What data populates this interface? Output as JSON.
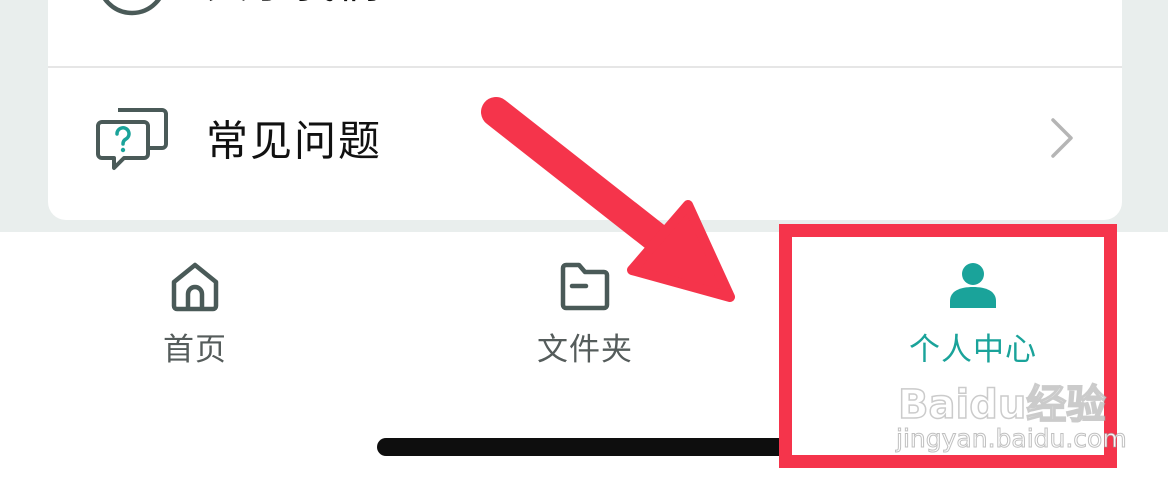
{
  "menu": {
    "items": [
      {
        "label": "关于我们",
        "icon": "info-circle-icon"
      },
      {
        "label": "常见问题",
        "icon": "question-chat-icon"
      }
    ]
  },
  "tabbar": {
    "tabs": [
      {
        "label": "首页",
        "icon": "home-icon",
        "active": false
      },
      {
        "label": "文件夹",
        "icon": "folder-icon",
        "active": false
      },
      {
        "label": "个人中心",
        "icon": "person-icon",
        "active": true
      }
    ]
  },
  "watermark": {
    "brand": "Baidu经验",
    "site": "jingyan.baidu.com"
  },
  "colors": {
    "accent": "#1aa39a",
    "annotation": "#f5344b",
    "background": "#e9eeed",
    "icon_gray": "#4a5a58"
  }
}
